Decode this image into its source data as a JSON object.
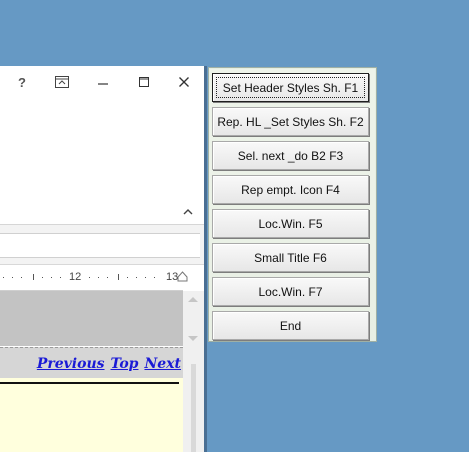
{
  "word_window": {
    "titlebar": {
      "help_label": "?",
      "close_label": "✕",
      "icons": [
        "help-icon",
        "ribbon-display-options-icon",
        "minimize-icon",
        "maximize-icon",
        "close-icon"
      ]
    },
    "ruler": {
      "numbers": [
        "12",
        "13"
      ]
    },
    "nav_links": [
      "Previous",
      "Top",
      "Next"
    ]
  },
  "panel": {
    "buttons": [
      {
        "label": "Set Header Styles Sh. F1",
        "focused": true
      },
      {
        "label": "Rep. HL _Set Styles Sh. F2"
      },
      {
        "label": "Sel. next _do B2 F3"
      },
      {
        "label": "Rep empt. Icon F4"
      },
      {
        "label": "Loc.Win. F5"
      },
      {
        "label": "Small Title F6"
      },
      {
        "label": "Loc.Win. F7"
      },
      {
        "label": "End"
      }
    ]
  },
  "colors": {
    "desktop": "#6699c4",
    "link": "#1a1ad6",
    "doc_background": "#ffffdd"
  }
}
